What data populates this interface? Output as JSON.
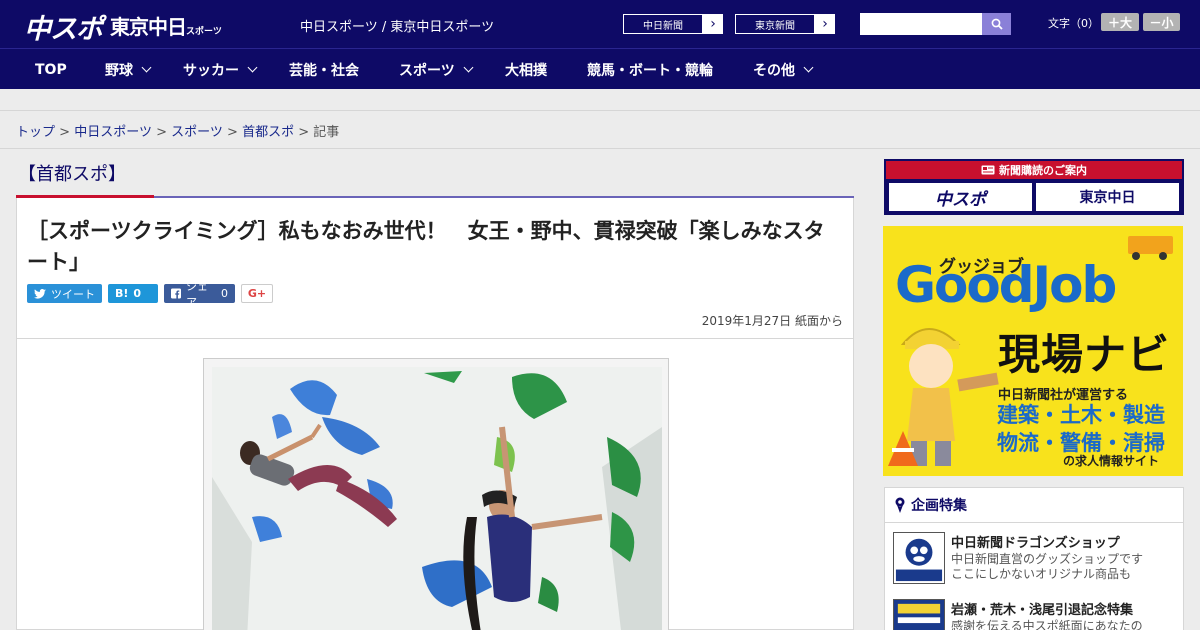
{
  "header": {
    "logo_chuspo": "中スポ",
    "logo_tokyo": "東京中日",
    "logo_tokyo_suffix": "スポーツ",
    "site_names": "中日スポーツ / 東京中日スポーツ",
    "ext_links": [
      "中日新聞",
      "東京新聞"
    ],
    "search_placeholder": "",
    "font_size_label": "文字（0）",
    "font_increase": "＋大",
    "font_decrease": "－小"
  },
  "nav": {
    "items": [
      {
        "label": "TOP",
        "dropdown": false
      },
      {
        "label": "野球",
        "dropdown": true
      },
      {
        "label": "サッカー",
        "dropdown": true
      },
      {
        "label": "芸能・社会",
        "dropdown": false
      },
      {
        "label": "スポーツ",
        "dropdown": true
      },
      {
        "label": "大相撲",
        "dropdown": false
      },
      {
        "label": "競馬・ボート・競輪",
        "dropdown": false
      },
      {
        "label": "その他",
        "dropdown": true
      }
    ]
  },
  "breadcrumb": {
    "links": [
      "トップ",
      "中日スポーツ",
      "スポーツ",
      "首都スポ"
    ],
    "current": "記事",
    "separator": ">"
  },
  "section": {
    "title": "【首都スポ】"
  },
  "article": {
    "headline": "［スポーツクライミング］私もなおみ世代！　女王・野中、貫禄突破「楽しみなスタート」",
    "share": {
      "tweet_label": "ツイート",
      "hatena_label": "B!",
      "hatena_count": "0",
      "facebook_label": "シェア",
      "facebook_count": "0",
      "gplus_label": "G+"
    },
    "date": "2019年1月27日 紙面から"
  },
  "sidebar": {
    "subscribe": {
      "title": "新聞購読のご案内",
      "logo_left": "中スポ",
      "logo_right": "東京中日"
    },
    "ad": {
      "tagline": "グッジョブ",
      "brand": "GoodJob",
      "headline": "現場ナビ",
      "sub": "中日新聞社が運営する",
      "jobs_line1": "建築・土木・製造",
      "jobs_line2": "物流・警備・清掃",
      "footer": "の求人情報サイト"
    },
    "feature": {
      "title": "企画特集",
      "items": [
        {
          "title": "中日新聞ドラゴンズショップ",
          "desc1": "中日新聞直営のグッズショップです",
          "desc2": "ここにしかないオリジナル商品も"
        },
        {
          "title": "岩瀬・荒木・浅尾引退記念特集",
          "desc1": "感謝を伝える中スポ紙面にあなたの",
          "desc2": ""
        }
      ]
    }
  },
  "colors": {
    "brand_navy": "#0e0a66",
    "accent_red": "#c8102e",
    "link_blue": "#1a2a8c",
    "ad_yellow": "#f8e21c"
  }
}
